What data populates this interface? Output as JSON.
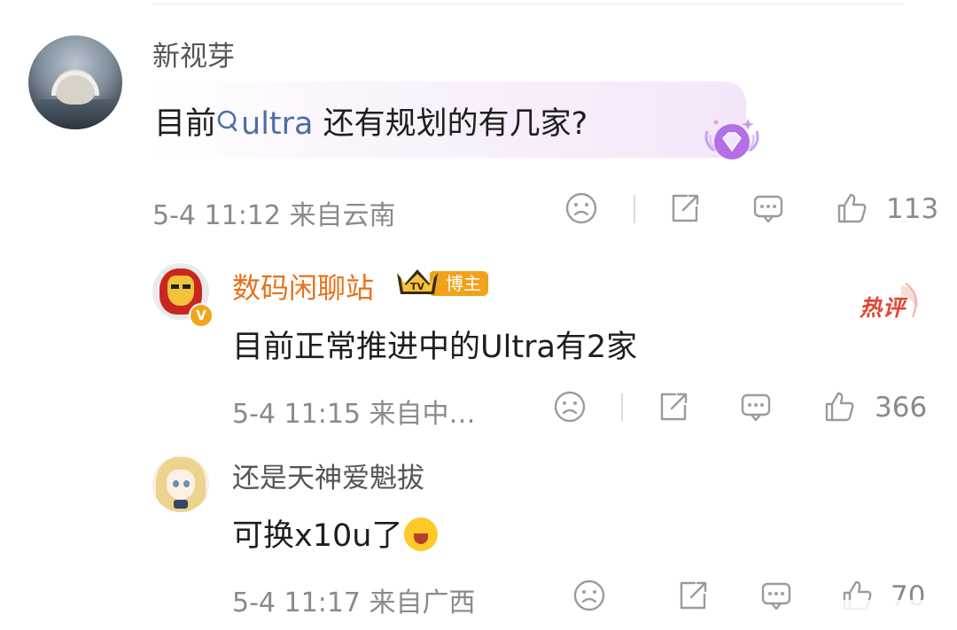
{
  "main_comment": {
    "username": "新视芽",
    "text_prefix": "目前",
    "link_text": "ultra",
    "text_suffix": " 还有规划的有几家?",
    "time": "5-4 11:12",
    "location": "来自云南",
    "like_count": "113"
  },
  "replies": [
    {
      "username": "数码闲聊站",
      "badge_label": "博主",
      "crown_text": "TV",
      "verified_mark": "V",
      "hot_label": "热评",
      "text": "目前正常推进中的Ultra有2家",
      "time": "5-4 11:15",
      "location": "来自中…",
      "like_count": "366"
    },
    {
      "username": "还是天神爱魁拔",
      "text": "可换x10u了",
      "time": "5-4 11:17",
      "location": "来自广西",
      "like_count": "70"
    }
  ],
  "icons": {
    "dislike": "sad-face-icon",
    "share": "share-icon",
    "comment": "comment-icon",
    "like": "thumbs-up-icon",
    "search": "search-icon"
  },
  "colors": {
    "username_blogger": "#e8711b",
    "link": "#4a6fa8",
    "badge": "#f0a21a",
    "hot": "#e5432f",
    "meta": "#8a8a8a"
  }
}
